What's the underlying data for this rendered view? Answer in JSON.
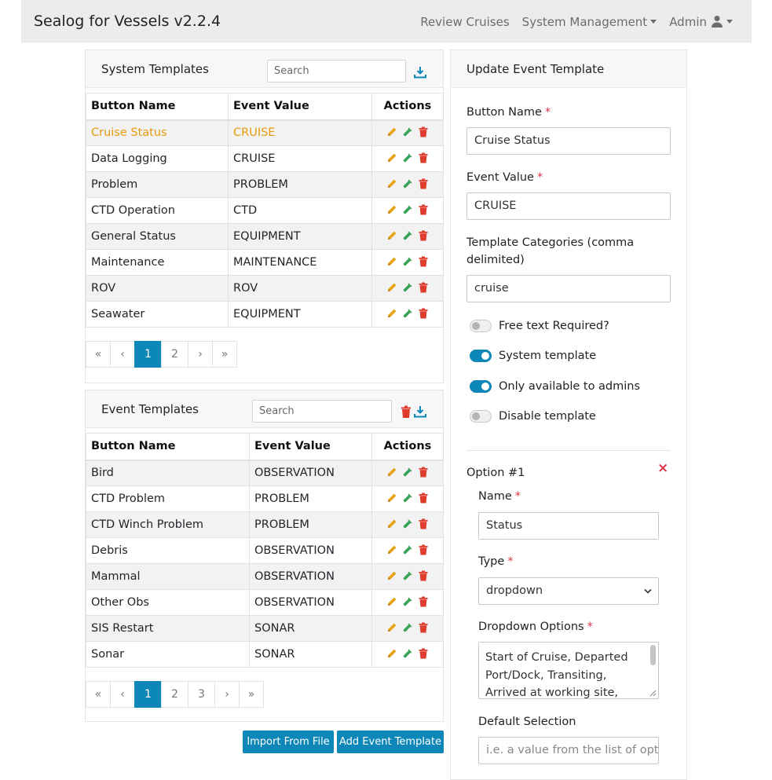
{
  "navbar": {
    "brand": "Sealog for Vessels v2.2.4",
    "links": [
      "Review Cruises",
      "System Management",
      "Admin"
    ]
  },
  "system_templates": {
    "title": "System Templates",
    "search_placeholder": "Search",
    "columns": [
      "Button Name",
      "Event Value",
      "Actions"
    ],
    "rows": [
      {
        "name": "Cruise Status",
        "value": "CRUISE",
        "active": true
      },
      {
        "name": "Data Logging",
        "value": "CRUISE"
      },
      {
        "name": "Problem",
        "value": "PROBLEM"
      },
      {
        "name": "CTD Operation",
        "value": "CTD"
      },
      {
        "name": "General Status",
        "value": "EQUIPMENT"
      },
      {
        "name": "Maintenance",
        "value": "MAINTENANCE"
      },
      {
        "name": "ROV",
        "value": "ROV"
      },
      {
        "name": "Seawater",
        "value": "EQUIPMENT"
      }
    ],
    "pagination": [
      "«",
      "‹",
      "1",
      "2",
      "›",
      "»"
    ],
    "current_page": "1"
  },
  "event_templates": {
    "title": "Event Templates",
    "search_placeholder": "Search",
    "columns": [
      "Button Name",
      "Event Value",
      "Actions"
    ],
    "rows": [
      {
        "name": "Bird",
        "value": "OBSERVATION"
      },
      {
        "name": "CTD Problem",
        "value": "PROBLEM"
      },
      {
        "name": "CTD Winch Problem",
        "value": "PROBLEM"
      },
      {
        "name": "Debris",
        "value": "OBSERVATION"
      },
      {
        "name": "Mammal",
        "value": "OBSERVATION"
      },
      {
        "name": "Other Obs",
        "value": "OBSERVATION"
      },
      {
        "name": "SIS Restart",
        "value": "SONAR"
      },
      {
        "name": "Sonar",
        "value": "SONAR"
      }
    ],
    "pagination": [
      "«",
      "‹",
      "1",
      "2",
      "3",
      "›",
      "»"
    ],
    "current_page": "1"
  },
  "buttons": {
    "import": "Import From File",
    "add": "Add Event Template"
  },
  "update_form": {
    "title": "Update Event Template",
    "button_name_label": "Button Name",
    "button_name_value": "Cruise Status",
    "event_value_label": "Event Value",
    "event_value_value": "CRUISE",
    "categories_label_1": "Template Categories (comma",
    "categories_label_2": "delimited)",
    "categories_value": "cruise",
    "toggles": [
      {
        "label": "Free text Required?",
        "on": false
      },
      {
        "label": "System template",
        "on": true
      },
      {
        "label": "Only available to admins",
        "on": true
      },
      {
        "label": "Disable template",
        "on": false
      }
    ],
    "option_title": "Option #1",
    "option_name_label": "Name",
    "option_name_value": "Status",
    "option_type_label": "Type",
    "option_type_value": "dropdown",
    "dropdown_options_label": "Dropdown Options",
    "dropdown_options_lines": [
      "Start of Cruise, Departed",
      "Port/Dock, Transiting,",
      "Arrived at working site,"
    ],
    "default_selection_label": "Default Selection",
    "default_selection_placeholder": "i.e. a value from the list of opti"
  },
  "colors": {
    "accent": "#0d86b8",
    "active_row": "#e89a0c",
    "edit_icon": "#e8a317",
    "beaker_icon": "#3aa35a",
    "trash_icon": "#e03c2e"
  }
}
